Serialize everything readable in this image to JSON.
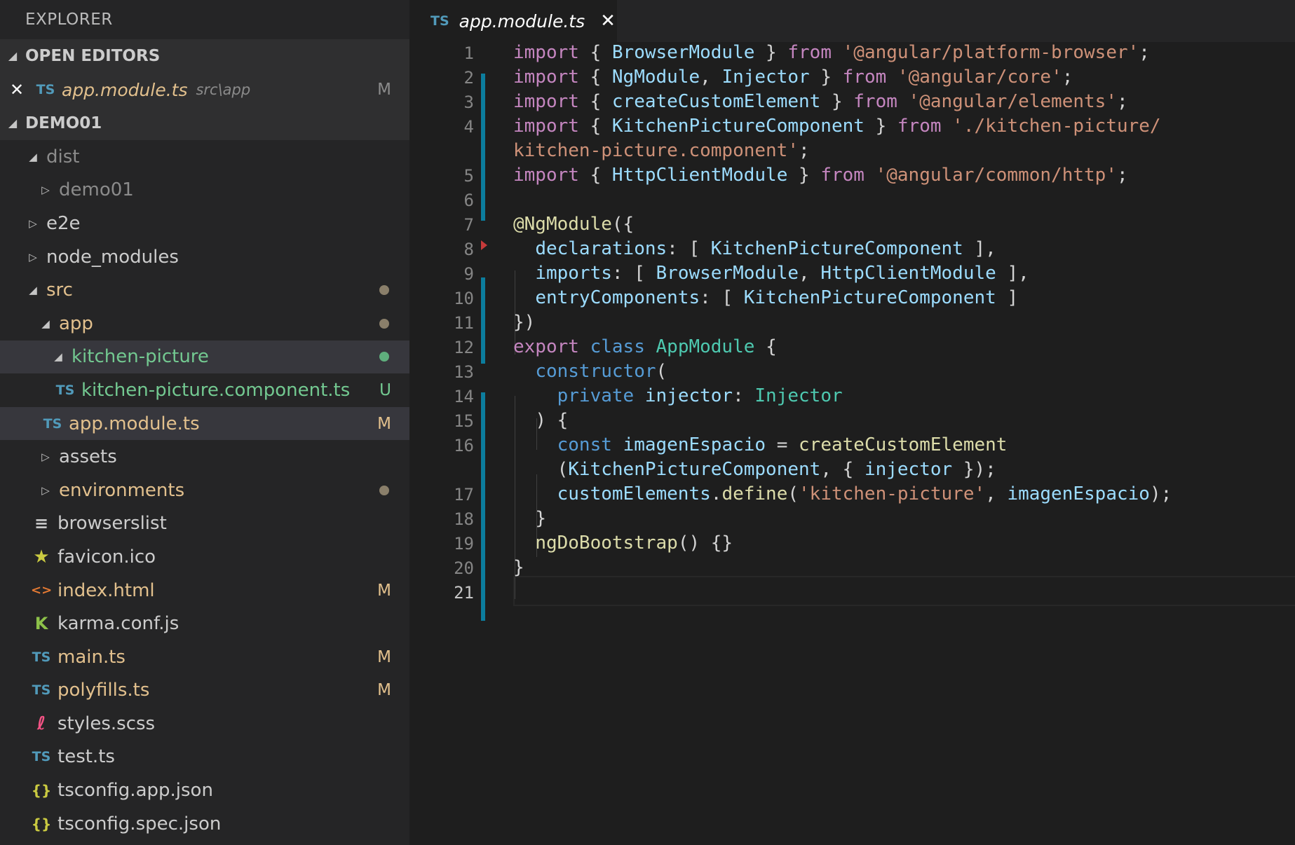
{
  "explorer": {
    "title": "EXPLORER",
    "open_editors": {
      "header": "OPEN EDITORS",
      "items": [
        {
          "close": "✕",
          "icon": "TS",
          "name": "app.module.ts",
          "path": "src\\app",
          "status": "M"
        }
      ]
    },
    "project": {
      "header": "DEMO01",
      "tree": [
        {
          "name": "dist",
          "caret": "◢",
          "icon": ""
        },
        {
          "name": "demo01",
          "caret": "▷",
          "icon": ""
        },
        {
          "name": "e2e",
          "caret": "▷",
          "icon": ""
        },
        {
          "name": "node_modules",
          "caret": "▷",
          "icon": ""
        },
        {
          "name": "src",
          "caret": "◢",
          "icon": ""
        },
        {
          "name": "app",
          "caret": "◢",
          "icon": ""
        },
        {
          "name": "kitchen-picture",
          "caret": "◢",
          "icon": ""
        },
        {
          "name": "kitchen-picture.component.ts",
          "caret": "",
          "icon": "TS",
          "status": "U"
        },
        {
          "name": "app.module.ts",
          "caret": "",
          "icon": "TS",
          "status": "M"
        },
        {
          "name": "assets",
          "caret": "▷",
          "icon": ""
        },
        {
          "name": "environments",
          "caret": "▷",
          "icon": ""
        },
        {
          "name": "browserslist",
          "caret": "",
          "icon": "≡"
        },
        {
          "name": "favicon.ico",
          "caret": "",
          "icon": "★"
        },
        {
          "name": "index.html",
          "caret": "",
          "icon": "<>",
          "status": "M"
        },
        {
          "name": "karma.conf.js",
          "caret": "",
          "icon": "K"
        },
        {
          "name": "main.ts",
          "caret": "",
          "icon": "TS",
          "status": "M"
        },
        {
          "name": "polyfills.ts",
          "caret": "",
          "icon": "TS",
          "status": "M"
        },
        {
          "name": "styles.scss",
          "caret": "",
          "icon": "ℓ"
        },
        {
          "name": "test.ts",
          "caret": "",
          "icon": "TS"
        },
        {
          "name": "tsconfig.app.json",
          "caret": "",
          "icon": "{}"
        },
        {
          "name": "tsconfig.spec.json",
          "caret": "",
          "icon": "{}"
        }
      ]
    }
  },
  "editor": {
    "tab": {
      "icon": "TS",
      "label": "app.module.ts",
      "close": "✕"
    },
    "line_numbers": [
      "1",
      "2",
      "3",
      "4",
      "5",
      "6",
      "7",
      "8",
      "9",
      "10",
      "11",
      "12",
      "13",
      "14",
      "15",
      "16",
      "17",
      "18",
      "19",
      "20",
      "21"
    ],
    "code": {
      "l1": [
        "import",
        "{",
        "BrowserModule",
        "}",
        "from",
        "'@angular/platform-browser'",
        ";"
      ],
      "l2": [
        "import",
        "{",
        "NgModule",
        ",",
        "Injector",
        "}",
        "from",
        "'@angular/core'",
        ";"
      ],
      "l3": [
        "import",
        "{",
        "createCustomElement",
        "}",
        "from",
        "'@angular/elements'",
        ";"
      ],
      "l4": [
        "import",
        "{",
        "KitchenPictureComponent",
        "}",
        "from",
        "'./kitchen-picture/"
      ],
      "l4b": [
        "kitchen-picture.component'",
        ";"
      ],
      "l5": [
        "import",
        "{",
        "HttpClientModule",
        "}",
        "from",
        "'@angular/common/http'",
        ";"
      ],
      "l7": [
        "@NgModule",
        "({"
      ],
      "l8": [
        "declarations",
        ":",
        "[",
        "KitchenPictureComponent",
        "],"
      ],
      "l9": [
        "imports",
        ":",
        "[",
        "BrowserModule",
        ",",
        "HttpClientModule",
        "],"
      ],
      "l10": [
        "entryComponents",
        ":",
        "[",
        "KitchenPictureComponent",
        "]"
      ],
      "l11": [
        "})"
      ],
      "l12": [
        "export",
        "class",
        "AppModule",
        "{"
      ],
      "l13": [
        "constructor",
        "("
      ],
      "l14": [
        "private",
        "injector",
        ":",
        "Injector"
      ],
      "l15": [
        ")",
        "{"
      ],
      "l16": [
        "const",
        "imagenEspacio",
        "=",
        "createCustomElement"
      ],
      "l16b": [
        "(",
        "KitchenPictureComponent",
        ",",
        "{",
        "injector",
        "});"
      ],
      "l17": [
        "customElements",
        ".",
        "define",
        "(",
        "'kitchen-picture'",
        ",",
        "imagenEspacio",
        ");"
      ],
      "l18": [
        "}"
      ],
      "l19": [
        "ngDoBootstrap",
        "()",
        "{}"
      ],
      "l20": [
        "}"
      ]
    }
  },
  "colors": {
    "sidebar_bg": "#252526",
    "editor_bg": "#1e1e1e",
    "modified": "#e2c08d",
    "untracked": "#73c991",
    "ts_icon": "#519aba",
    "change_bar": "#0c7d9d"
  }
}
